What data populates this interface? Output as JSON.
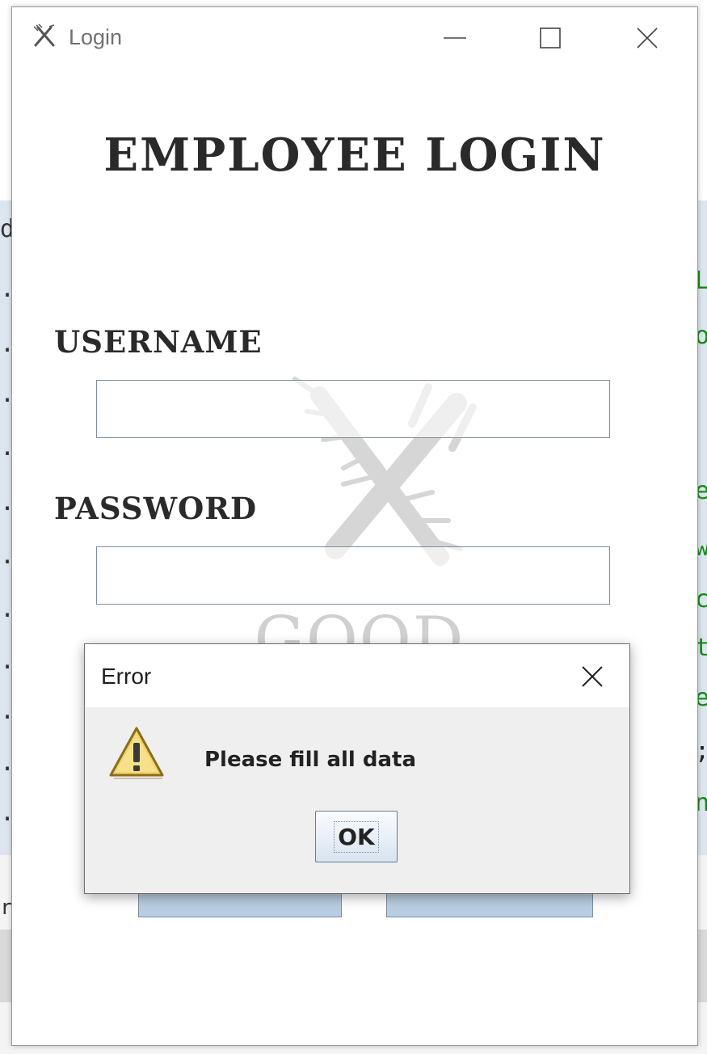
{
  "window": {
    "title": "Login",
    "heading": "EMPLOYEE LOGIN",
    "username_label": "USERNAME",
    "password_label": "PASSWORD",
    "username_value": "",
    "password_value": "",
    "watermark_text": "GOOD TASTE"
  },
  "dialog": {
    "title": "Error",
    "message": "Please fill all data",
    "ok_label": "OK",
    "icon": "warning-icon"
  },
  "colors": {
    "heading": "#2a2a2a",
    "input_border": "#7a8ea3",
    "button_fill": "#b9cde0",
    "dialog_bg": "#efefef",
    "warning_yellow": "#f2d46b"
  }
}
